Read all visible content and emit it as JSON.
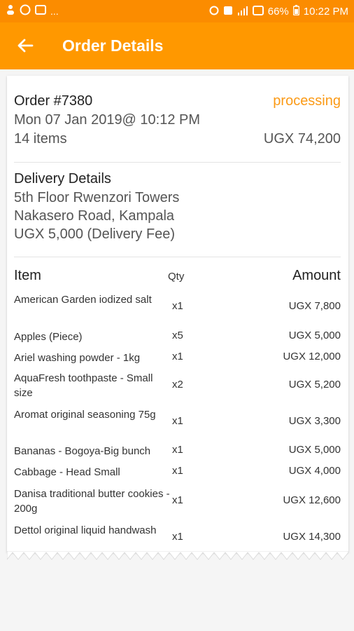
{
  "status_bar": {
    "left_dots": "...",
    "battery": "66%",
    "time": "10:22 PM"
  },
  "app_bar": {
    "title": "Order Details",
    "back_icon": "arrow-left-icon"
  },
  "order": {
    "number": "Order #7380",
    "status": "processing",
    "date": "Mon 07 Jan 2019@ 10:12 PM",
    "items_count": "14 items",
    "total": "UGX 74,200"
  },
  "delivery": {
    "title": "Delivery Details",
    "line1": "5th Floor Rwenzori Towers",
    "line2": "Nakasero Road, Kampala",
    "fee": "UGX 5,000 (Delivery Fee)"
  },
  "table": {
    "headers": {
      "item": "Item",
      "qty": "Qty",
      "amount": "Amount"
    },
    "rows": [
      {
        "name": "American Garden iodized salt",
        "qty": "x1",
        "amount": "UGX 7,800"
      },
      {
        "name": "Apples (Piece)",
        "qty": "x5",
        "amount": "UGX 5,000"
      },
      {
        "name": "Ariel washing powder - 1kg",
        "qty": "x1",
        "amount": "UGX 12,000"
      },
      {
        "name": "AquaFresh toothpaste - Small size",
        "qty": "x2",
        "amount": "UGX 5,200"
      },
      {
        "name": "Aromat original seasoning 75g",
        "qty": "x1",
        "amount": "UGX 3,300"
      },
      {
        "name": "Bananas - Bogoya-Big bunch",
        "qty": "x1",
        "amount": "UGX 5,000"
      },
      {
        "name": "Cabbage - Head Small",
        "qty": "x1",
        "amount": "UGX 4,000"
      },
      {
        "name": "Danisa traditional butter cookies - 200g",
        "qty": "x1",
        "amount": "UGX 12,600"
      },
      {
        "name": "Dettol original liquid handwash",
        "qty": "x1",
        "amount": "UGX 14,300"
      }
    ]
  },
  "colors": {
    "status_bar": "#fb8c00",
    "app_bar": "#ff9800",
    "status_text": "#fb9a16"
  }
}
